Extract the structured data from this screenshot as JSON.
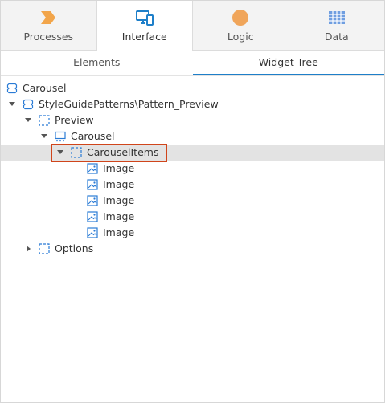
{
  "main_tabs": [
    {
      "label": "Processes",
      "icon": "processes-chevron-icon",
      "active": false
    },
    {
      "label": "Interface",
      "icon": "interface-devices-icon",
      "active": true
    },
    {
      "label": "Logic",
      "icon": "logic-circle-icon",
      "active": false
    },
    {
      "label": "Data",
      "icon": "data-grid-icon",
      "active": false
    }
  ],
  "sub_tabs": [
    {
      "label": "Elements",
      "active": false
    },
    {
      "label": "Widget Tree",
      "active": true
    }
  ],
  "tree": [
    {
      "label": "Carousel",
      "icon": "block-icon"
    },
    {
      "label": "StyleGuidePatterns\\Pattern_Preview",
      "icon": "block-icon",
      "expanded": true
    },
    {
      "label": "Preview",
      "icon": "placeholder-icon",
      "expanded": true
    },
    {
      "label": "Carousel",
      "icon": "web-block-icon",
      "expanded": true
    },
    {
      "label": "CarouselItems",
      "icon": "placeholder-icon",
      "expanded": true,
      "selected": true
    },
    {
      "label": "Image",
      "icon": "image-icon"
    },
    {
      "label": "Image",
      "icon": "image-icon"
    },
    {
      "label": "Image",
      "icon": "image-icon"
    },
    {
      "label": "Image",
      "icon": "image-icon"
    },
    {
      "label": "Image",
      "icon": "image-icon"
    },
    {
      "label": "Options",
      "icon": "placeholder-icon",
      "expanded": false
    }
  ],
  "colors": {
    "processes_icon": "#f2a54a",
    "interface_icon": "#1e7fc9",
    "logic_icon": "#f0a55a",
    "data_icon": "#6f9ee0",
    "tree_icon_blue": "#2a7bd5",
    "selection_outline": "#d0451b"
  }
}
